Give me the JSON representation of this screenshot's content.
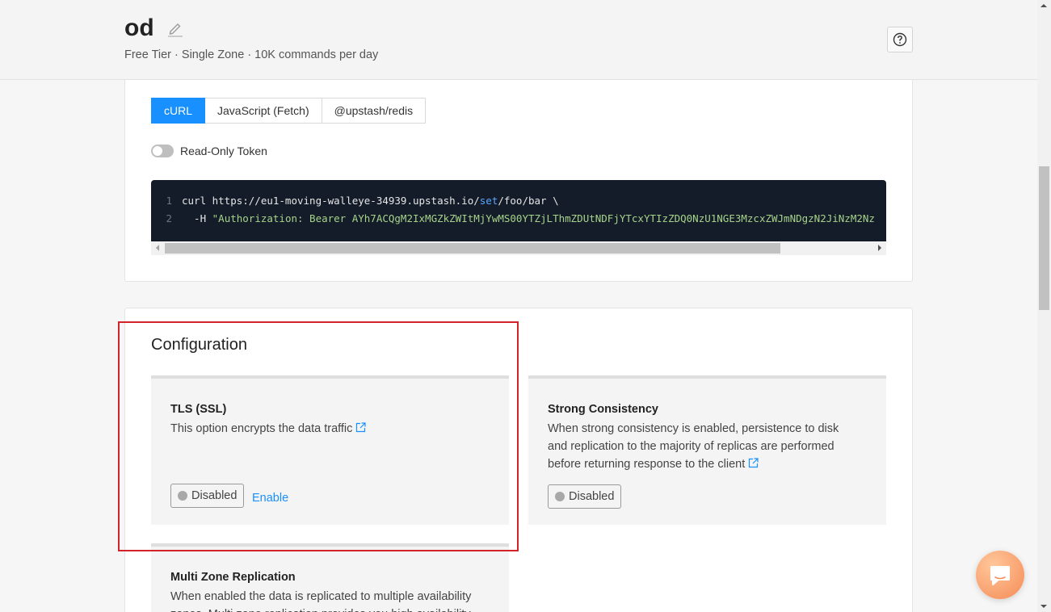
{
  "header": {
    "title": "od",
    "subtitle": "Free Tier · Single Zone · 10K commands per day"
  },
  "connect": {
    "tabs": [
      "cURL",
      "JavaScript (Fetch)",
      "@upstash/redis"
    ],
    "active_tab": "cURL",
    "readonly_label": "Read-Only Token",
    "readonly_enabled": false,
    "code": {
      "line1_num": "1",
      "line1_cmd": "curl https://eu1-moving-walleye-34939.upstash.io/",
      "line1_path_a": "set",
      "line1_path_b": "/foo/bar \\",
      "line2_num": "2",
      "line2_flag": "  -H ",
      "line2_value": "\"Authorization: Bearer AYh7ACQgM2IxMGZkZWItMjYwMS00YTZjLThmZDUtNDFjYTcxYTIzZDQ0NzU1NGE3MzcxZWJmNDgzN2JiNzM2Nz"
    }
  },
  "configuration": {
    "title": "Configuration",
    "tls": {
      "title": "TLS (SSL)",
      "description": "This option encrypts the data traffic",
      "status": "Disabled",
      "action": "Enable"
    },
    "strong_consistency": {
      "title": "Strong Consistency",
      "description": "When strong consistency is enabled, persistence to disk and replication to the majority of replicas are performed before returning response to the client",
      "status": "Disabled"
    },
    "multi_zone": {
      "title": "Multi Zone Replication",
      "description": "When enabled the data is replicated to multiple availability zones. Multi zone replication provides you high availability"
    }
  },
  "icons": {
    "edit": "pencil-icon",
    "help": "question-circle-icon",
    "external_link": "external-link-icon",
    "chat": "chat-bubble-icon"
  },
  "colors": {
    "accent": "#1890ff",
    "highlight": "#d2232a",
    "code_bg": "#141c29"
  }
}
